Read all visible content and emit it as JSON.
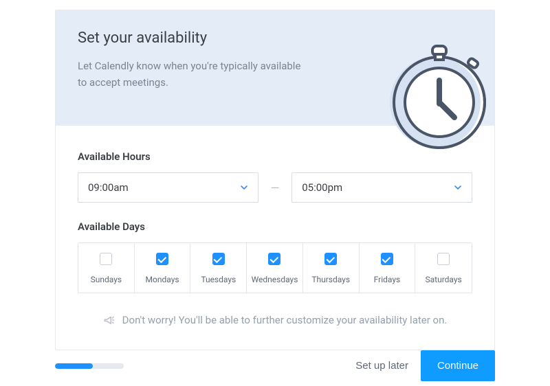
{
  "header": {
    "title": "Set your availability",
    "subtitle": "Let Calendly know when you're typically available to accept meetings."
  },
  "hours": {
    "label": "Available Hours",
    "start": "09:00am",
    "end": "05:00pm",
    "separator": "—"
  },
  "days": {
    "label": "Available Days",
    "items": [
      {
        "label": "Sundays",
        "checked": false
      },
      {
        "label": "Mondays",
        "checked": true
      },
      {
        "label": "Tuesdays",
        "checked": true
      },
      {
        "label": "Wednesdays",
        "checked": true
      },
      {
        "label": "Thursdays",
        "checked": true
      },
      {
        "label": "Fridays",
        "checked": true
      },
      {
        "label": "Saturdays",
        "checked": false
      }
    ]
  },
  "note": "Don't worry! You'll be able to further customize your availability later on.",
  "footer": {
    "progress_percent": 55,
    "setup_later_label": "Set up later",
    "continue_label": "Continue"
  },
  "colors": {
    "primary": "#0f9bff",
    "header_bg": "#e4ecf7"
  }
}
